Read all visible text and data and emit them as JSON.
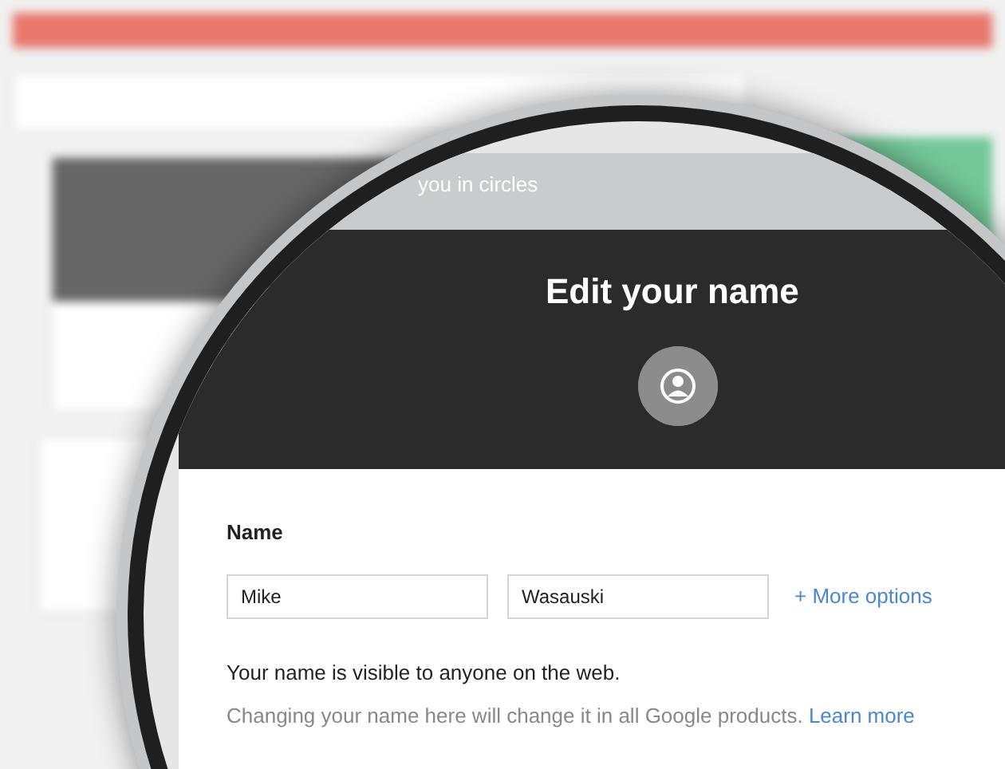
{
  "dialog": {
    "header_text": "you in circles",
    "title": "Edit your name",
    "name_label": "Name",
    "first_name": "Mike",
    "last_name": "Wasauski",
    "more_options": "+ More options",
    "notice": "Your name is visible to anyone on the web.",
    "note": "Changing your name here will change it in all Google products.",
    "note_link": "Learn more"
  }
}
